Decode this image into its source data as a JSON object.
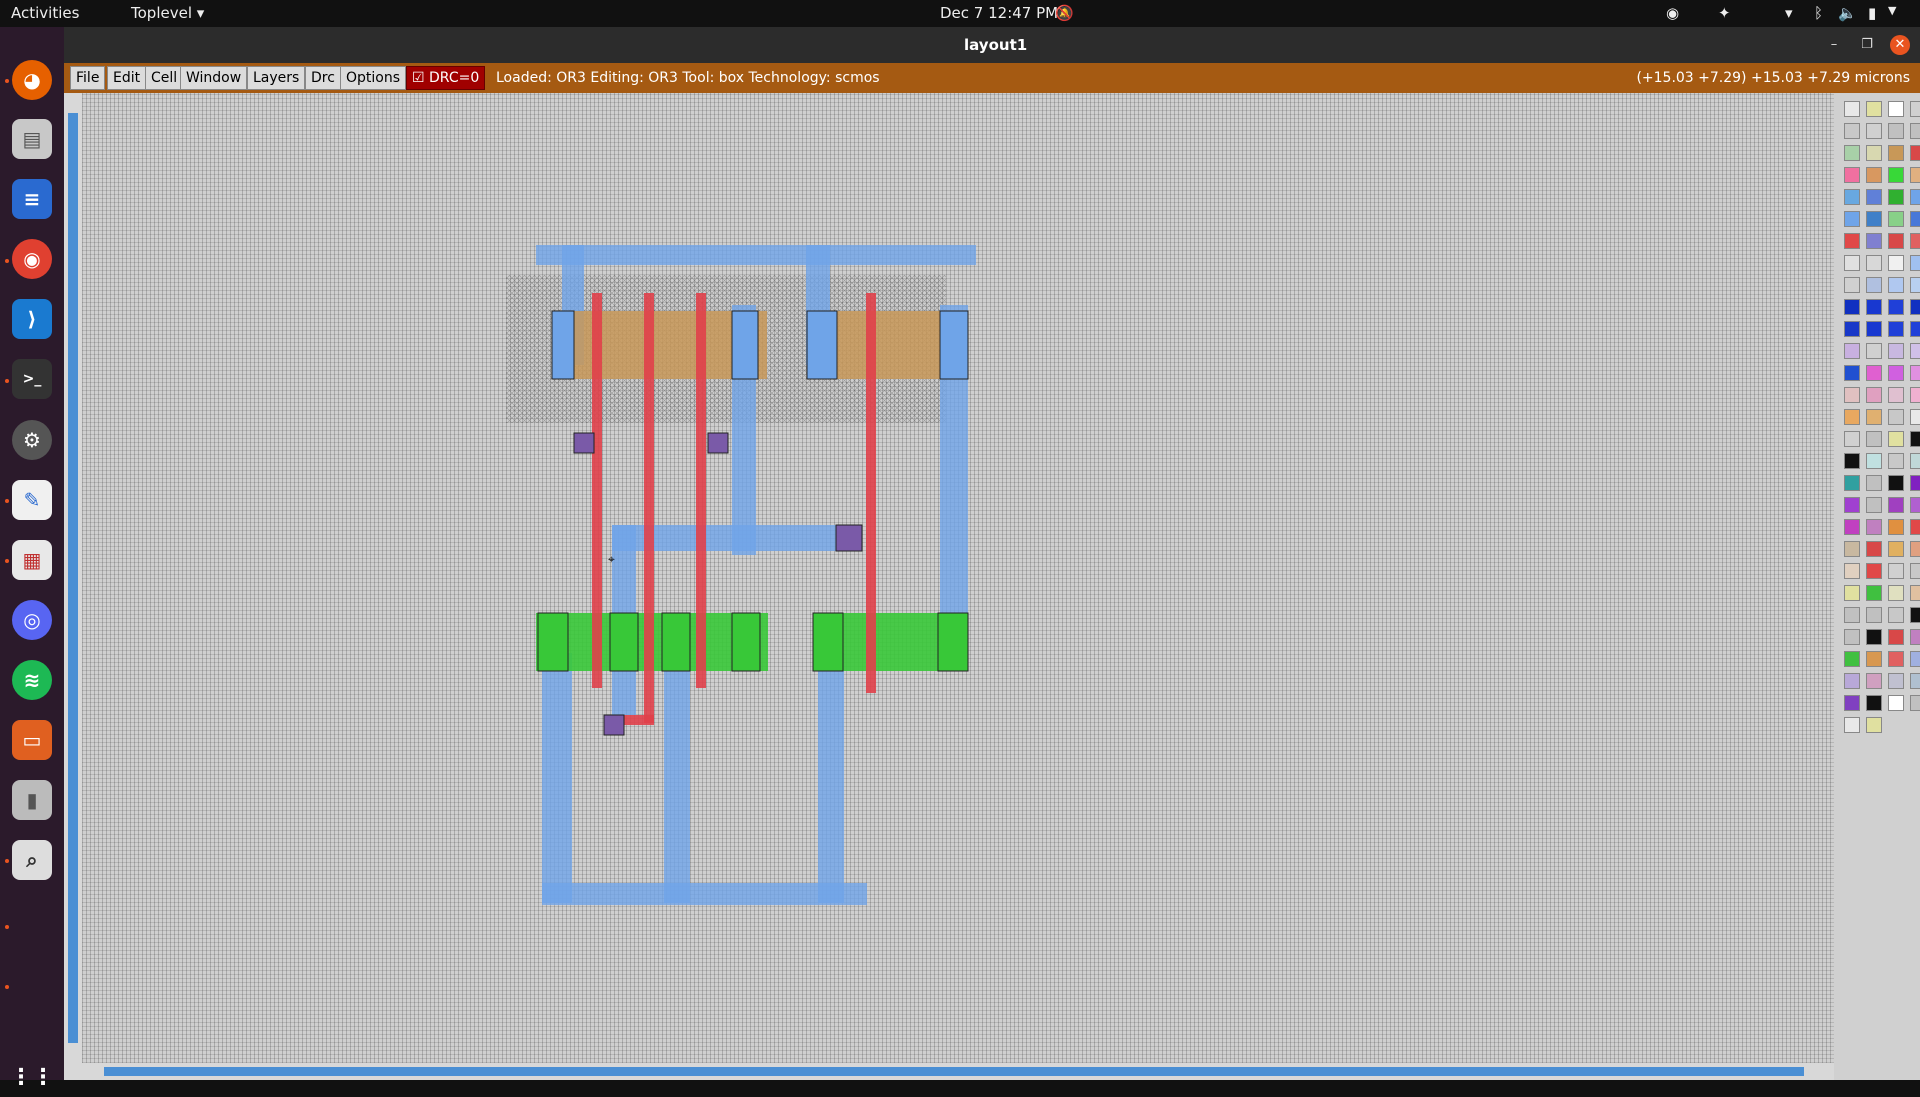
{
  "topbar": {
    "activities": "Activities",
    "app_menu": "Toplevel",
    "clock": "Dec 7  12:47 PM"
  },
  "window": {
    "title": "layout1"
  },
  "menubar": {
    "file": "File",
    "edit": "Edit",
    "cell": "Cell",
    "window": "Window",
    "layers": "Layers",
    "drc": "Drc",
    "options": "Options",
    "drc_status": "DRC=0",
    "status": "Loaded: OR3  Editing: OR3  Tool: box   Technology: scmos",
    "coords": "(+15.03 +7.29) +15.03 +7.29 microns"
  },
  "dock": {
    "apps": [
      "firefox-icon",
      "files-icon",
      "writer-icon",
      "chrome-icon",
      "vscode-icon",
      "terminal-icon",
      "settings-icon",
      "text-editor-icon",
      "screenshot-icon",
      "discord-icon",
      "spotify-icon",
      "impress-icon",
      "usb-drive-icon",
      "magnifier-icon"
    ]
  },
  "colors": {
    "metal1": "#6fa4e8",
    "poly": "#e0404a",
    "pdiff": "#c89858",
    "ndiff": "#38c838",
    "contact": "#7a5aa8",
    "menubar": "#a55a12"
  },
  "palette_colors": [
    "#e8e8e8",
    "#e0e0a0",
    "#ffffff",
    "#d0d0d0",
    "#c8c8c8",
    "#d0d0d0",
    "#c0c0c0",
    "#c0c0c0",
    "#a8d0a8",
    "#d8d8b0",
    "#c89858",
    "#d84848",
    "#f070a0",
    "#d89860",
    "#38d838",
    "#e0b080",
    "#68a8e0",
    "#6080d8",
    "#30b030",
    "#6fa4e8",
    "#6fa4e8",
    "#4080c8",
    "#88d088",
    "#4878d8",
    "#e04848",
    "#8080d0",
    "#d84848",
    "#e06060",
    "#e0e0e0",
    "#d8d8d8",
    "#f0f0f0",
    "#a0c0f0",
    "#d0d0d0",
    "#b0c0e0",
    "#b0c8f0",
    "#b8d0f0",
    "#1030c0",
    "#1838d0",
    "#2040d8",
    "#1030c0",
    "#1838c8",
    "#1838d0",
    "#2040d8",
    "#2040d8",
    "#c8b0e0",
    "#d0d0d0",
    "#c8b8e0",
    "#d0c0e8",
    "#2050d0",
    "#e060d0",
    "#d060e0",
    "#e090e0",
    "#e0c0c0",
    "#e0a0c0",
    "#e0c0d0",
    "#f0b0d0",
    "#e8a860",
    "#e0b070",
    "#c8c8c8",
    "#e8e8e8",
    "#d0d0d0",
    "#c0c0c0",
    "#e0e0a0",
    "#111111",
    "#111111",
    "#c0e0e0",
    "#c8c8c8",
    "#c0d8d8",
    "#30a0a0",
    "#c0c0c0",
    "#111111",
    "#8020c0",
    "#a040d0",
    "#c0c0c0",
    "#a040c0",
    "#b060d0",
    "#c040c0",
    "#c080c0",
    "#e09040",
    "#e04848",
    "#c8b8a0",
    "#d84848",
    "#e0b060",
    "#e0a080",
    "#e0d0c0",
    "#e04848",
    "#d0d0d0",
    "#c8c8c8",
    "#e0e0a0",
    "#40c040",
    "#e0e0c0",
    "#e0c0a0",
    "#c0c0c0",
    "#c0c0c0",
    "#c8c8c8",
    "#111111",
    "#c0c0c0",
    "#111111",
    "#d84848",
    "#c080c0",
    "#40c040",
    "#d89850",
    "#e06060",
    "#a0b0e0",
    "#b8a8d8",
    "#d0a0c0",
    "#c0c0d0",
    "#b0c0d0",
    "#8040c0",
    "#111111",
    "#ffffff",
    "#c0c0c0",
    "#e8e8e8",
    "#e0e0a0"
  ]
}
